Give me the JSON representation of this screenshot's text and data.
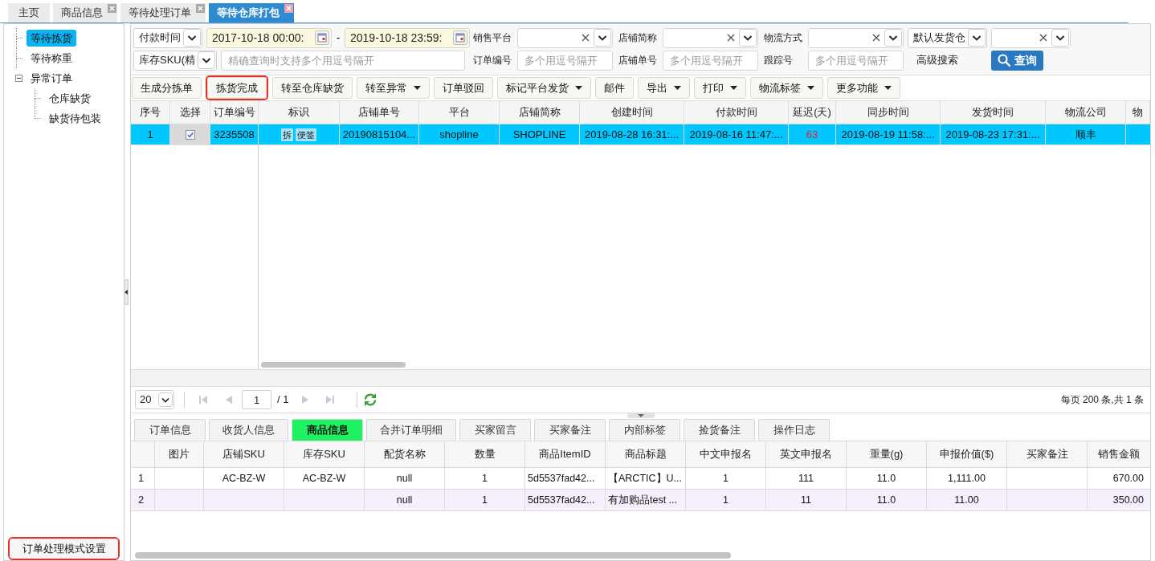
{
  "tabs": [
    {
      "label": "主页",
      "selected": false,
      "closable": false
    },
    {
      "label": "商品信息",
      "selected": false,
      "closable": true
    },
    {
      "label": "等待处理订单",
      "selected": false,
      "closable": true
    },
    {
      "label": "等待仓库打包",
      "selected": true,
      "closable": true
    }
  ],
  "sidebar": {
    "tree": [
      {
        "label": "等待拣货",
        "selected": true
      },
      {
        "label": "等待称重",
        "selected": false
      },
      {
        "label": "异常订单",
        "selected": false,
        "expanded": true,
        "children": [
          {
            "label": "仓库缺货",
            "selected": false
          },
          {
            "label": "缺货待包装",
            "selected": false
          }
        ]
      }
    ],
    "settings_button": {
      "label": "订单处理模式设置",
      "highlighted": true
    }
  },
  "filters": {
    "rows": [
      {
        "main": [
          {
            "kind": "select",
            "value": "付款时间"
          },
          {
            "kind": "date",
            "value": "2017-10-18 00:00:"
          },
          {
            "kind": "separator",
            "label": "-"
          },
          {
            "kind": "date",
            "value": "2019-10-18 23:59:"
          }
        ],
        "fields": [
          {
            "kind": "label",
            "label": "销售平台"
          },
          {
            "kind": "combo"
          },
          {
            "kind": "label",
            "label": "店铺简称"
          },
          {
            "kind": "combo"
          },
          {
            "kind": "label",
            "label": "物流方式"
          },
          {
            "kind": "combo"
          },
          {
            "kind": "select",
            "value": "默认发货仓"
          },
          {
            "kind": "combo"
          }
        ]
      },
      {
        "main": [
          {
            "kind": "select",
            "value": "库存SKU(精"
          },
          {
            "kind": "input",
            "placeholder": "精确查询时支持多个用逗号隔开"
          }
        ],
        "fields": [
          {
            "kind": "label",
            "label": "订单编号"
          },
          {
            "kind": "input",
            "placeholder": "多个用逗号隔开"
          },
          {
            "kind": "label",
            "label": "店铺单号"
          },
          {
            "kind": "input",
            "placeholder": "多个用逗号隔开"
          },
          {
            "kind": "label",
            "label": "跟踪号"
          },
          {
            "kind": "input",
            "placeholder": "多个用逗号隔开"
          },
          {
            "kind": "link",
            "label": "高级搜索"
          },
          {
            "kind": "button",
            "label": "查询"
          }
        ]
      }
    ]
  },
  "toolbar": [
    {
      "label": "生成分拣单",
      "dropdown": false,
      "highlighted": false
    },
    {
      "label": "拣货完成",
      "dropdown": false,
      "highlighted": true
    },
    {
      "label": "转至仓库缺货",
      "dropdown": false,
      "highlighted": false
    },
    {
      "label": "转至异常",
      "dropdown": true,
      "highlighted": false
    },
    {
      "label": "订单驳回",
      "dropdown": false,
      "highlighted": false
    },
    {
      "label": "标记平台发货",
      "dropdown": true,
      "highlighted": false
    },
    {
      "label": "邮件",
      "dropdown": false,
      "highlighted": false
    },
    {
      "label": "导出",
      "dropdown": true,
      "highlighted": false
    },
    {
      "label": "打印",
      "dropdown": true,
      "highlighted": false
    },
    {
      "label": "物流标签",
      "dropdown": true,
      "highlighted": false
    },
    {
      "label": "更多功能",
      "dropdown": true,
      "highlighted": false
    }
  ],
  "orders": {
    "columns": [
      "序号",
      "选择",
      "订单编号",
      "标识",
      "店铺单号",
      "平台",
      "店铺简称",
      "创建时间",
      "付款时间",
      "延迟(天)",
      "同步时间",
      "发货时间",
      "物流公司",
      "物"
    ],
    "rows": [
      {
        "selected": true,
        "number": "1",
        "checked": true,
        "order_no": "3235508",
        "tags": [
          "拆",
          "便签"
        ],
        "store_order_no": "20190815104...",
        "platform": "shopline",
        "store_name": "SHOPLINE",
        "created_at": "2019-08-28 16:31:...",
        "paid_at": "2019-08-16 11:47:...",
        "delay_days": "63",
        "delay_alert": true,
        "synced_at": "2019-08-19 11:58:...",
        "shipped_at": "2019-08-23 17:31:...",
        "carrier": "顺丰"
      }
    ]
  },
  "pagination": {
    "page_size": "20",
    "first": {
      "disabled": true
    },
    "previous": {
      "disabled": true
    },
    "page": "1",
    "page_total": "/ 1",
    "next": {
      "disabled": true
    },
    "last": {
      "disabled": true
    },
    "summary": "每页 200 条,共 1 条"
  },
  "detail_tabs": [
    {
      "label": "订单信息",
      "selected": false
    },
    {
      "label": "收货人信息",
      "selected": false
    },
    {
      "label": "商品信息",
      "selected": true
    },
    {
      "label": "合并订单明细",
      "selected": false
    },
    {
      "label": "买家留言",
      "selected": false
    },
    {
      "label": "买家备注",
      "selected": false
    },
    {
      "label": "内部标签",
      "selected": false
    },
    {
      "label": "捡货备注",
      "selected": false
    },
    {
      "label": "操作日志",
      "selected": false
    }
  ],
  "items": {
    "columns": [
      "图片",
      "店铺SKU",
      "库存SKU",
      "配货名称",
      "数量",
      "商品ItemID",
      "商品标题",
      "中文申报名",
      "英文申报名",
      "重量(g)",
      "申报价值($)",
      "买家备注",
      "销售金额"
    ],
    "rows": [
      {
        "row_number": "1",
        "cells": [
          null,
          "AC-BZ-W",
          "AC-BZ-W",
          "null",
          "1",
          "5d5537fad42...",
          "【ARCTIC】U...",
          "1",
          "111",
          "11.0",
          "1,111.00",
          null,
          "670.00"
        ]
      },
      {
        "row_number": "2",
        "cells": [
          null,
          null,
          null,
          "null",
          "1",
          "5d5537fad42...",
          "有加购品test ...",
          "1",
          "11",
          "11.0",
          "11.00",
          null,
          "350.00"
        ]
      }
    ]
  }
}
